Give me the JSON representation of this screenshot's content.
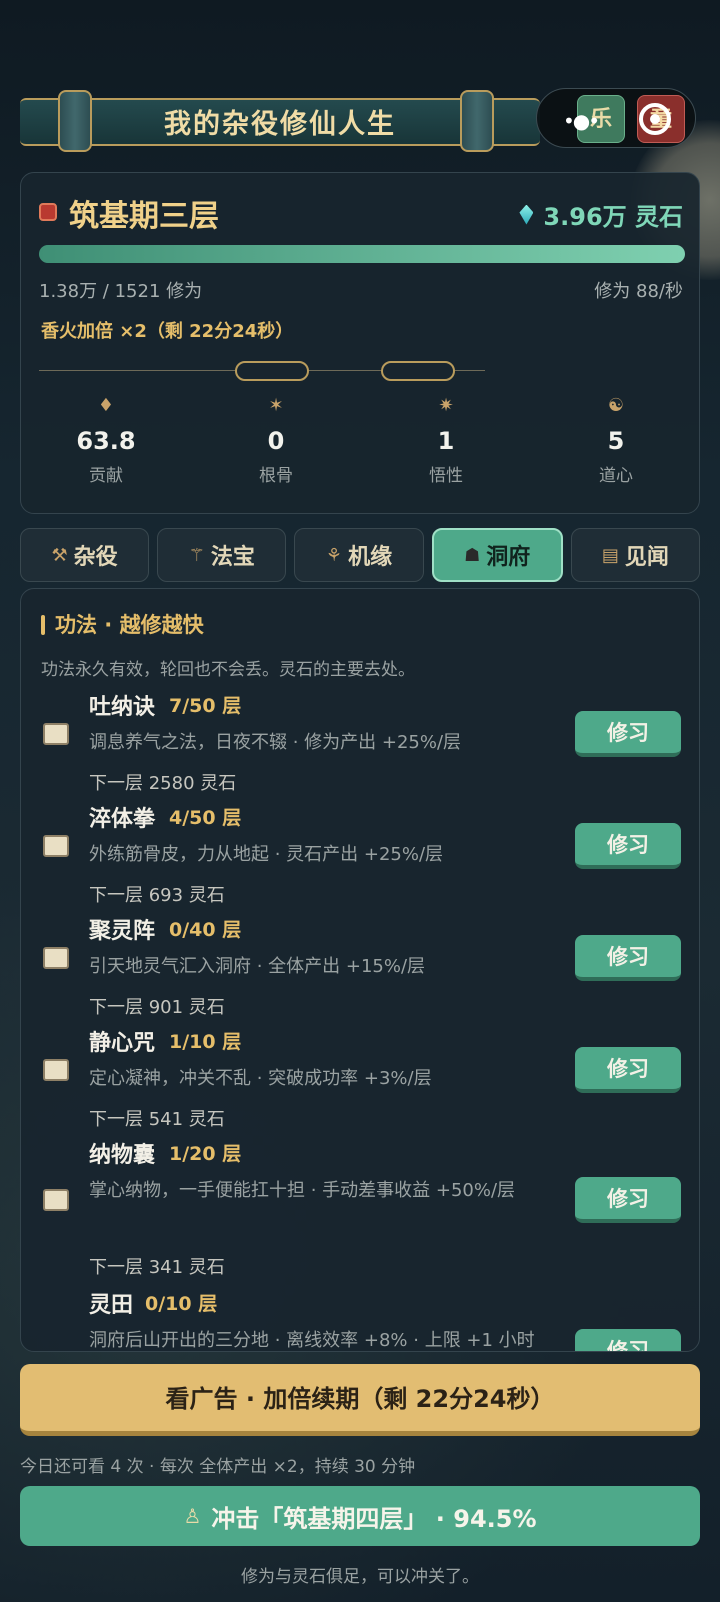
{
  "app": {
    "title": "我的杂役修仙人生"
  },
  "capsule": {
    "left_btn": "乐",
    "right_btn": "童"
  },
  "status": {
    "realm": "筑基期三层",
    "spirit_stones": "3.96万 灵石",
    "progress": 1.0,
    "cultivation": "1.38万 / 1521 修为",
    "rate": "修为 88/秒",
    "boost": "香火加倍 ×2（剩 22分24秒）",
    "stats": [
      {
        "icon": "contribution-icon",
        "value": "63.8",
        "label": "贡献"
      },
      {
        "icon": "bone-icon",
        "value": "0",
        "label": "根骨"
      },
      {
        "icon": "insight-icon",
        "value": "1",
        "label": "悟性"
      },
      {
        "icon": "heart-icon",
        "value": "5",
        "label": "道心"
      }
    ]
  },
  "tabs": [
    {
      "label": "杂役",
      "icon": "broom-icon",
      "active": false
    },
    {
      "label": "法宝",
      "icon": "treasure-icon",
      "active": false
    },
    {
      "label": "机缘",
      "icon": "fortune-icon",
      "active": false
    },
    {
      "label": "洞府",
      "icon": "cave-icon",
      "active": true
    },
    {
      "label": "见闻",
      "icon": "scroll-icon",
      "active": false
    }
  ],
  "section": {
    "title": "功法 · 越修越快",
    "desc": "功法永久有效，轮回也不会丢。灵石的主要去处。"
  },
  "skills": [
    {
      "name": "吐纳诀",
      "level": "7/50 层",
      "desc": "调息养气之法，日夜不辍 · 修为产出 +25%/层",
      "cost": "下一层 2580 灵石",
      "button": "修习"
    },
    {
      "name": "淬体拳",
      "level": "4/50 层",
      "desc": "外练筋骨皮，力从地起 · 灵石产出 +25%/层",
      "cost": "下一层 693 灵石",
      "button": "修习"
    },
    {
      "name": "聚灵阵",
      "level": "0/40 层",
      "desc": "引天地灵气汇入洞府 · 全体产出 +15%/层",
      "cost": "下一层 901 灵石",
      "button": "修习"
    },
    {
      "name": "静心咒",
      "level": "1/10 层",
      "desc": "定心凝神，冲关不乱 · 突破成功率 +3%/层",
      "cost": "下一层 541 灵石",
      "button": "修习"
    },
    {
      "name": "纳物囊",
      "level": "1/20 层",
      "desc": "掌心纳物，一手便能扛十担 · 手动差事收益 +50%/层",
      "cost": "下一层 341 灵石",
      "button": "修习"
    },
    {
      "name": "灵田",
      "level": "0/10 层",
      "desc": "洞府后山开出的三分地 · 离线效率 +8% · 上限 +1 小时",
      "cost": "",
      "button": "修习"
    }
  ],
  "bottom": {
    "ad_button": "看广告 · 加倍续期（剩 22分24秒）",
    "ad_note": "今日还可看 4 次 · 每次 全体产出 ×2，持续 30 分钟",
    "breakthrough": "冲击「筑基期四层」 · 94.5%",
    "foot_note": "修为与灵石俱足，可以冲关了。"
  }
}
